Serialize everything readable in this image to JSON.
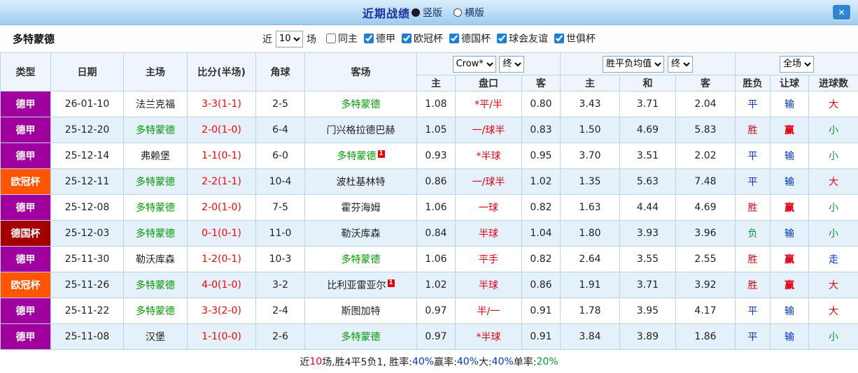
{
  "palette": {
    "red": "#e60012",
    "blue": "#0033cc",
    "green": "#009933",
    "team_green": "#009900",
    "score_red": "#ff0000",
    "handicap_red": "#e60012",
    "league_purple": "#a0009e",
    "league_orange": "#ff5400",
    "league_darkred": "#a40000",
    "row_alt": "#e4f0fa",
    "border": "#bcd4e8"
  },
  "titlebar": {
    "title": "近期战绩",
    "layout_options": [
      {
        "label": "竖版",
        "selected": true
      },
      {
        "label": "横版",
        "selected": false
      }
    ],
    "close_glyph": "✕"
  },
  "filterbar": {
    "team": "多特蒙德",
    "near_label": "近",
    "count_value": "10",
    "games_label": "场",
    "checkboxes": [
      {
        "label": "同主",
        "checked": false
      },
      {
        "label": "德甲",
        "checked": true
      },
      {
        "label": "欧冠杯",
        "checked": true
      },
      {
        "label": "德国杯",
        "checked": true
      },
      {
        "label": "球会友谊",
        "checked": true
      },
      {
        "label": "世俱杯",
        "checked": true
      }
    ]
  },
  "table": {
    "headers": {
      "type": "类型",
      "date": "日期",
      "home": "主场",
      "score": "比分(半场)",
      "corner": "角球",
      "away": "客场",
      "odds_provider": "Crow*",
      "odds_final": "终",
      "avg_label": "胜平负均值",
      "avg_final": "终",
      "period_label": "全场",
      "sub": [
        "主",
        "盘口",
        "客",
        "主",
        "和",
        "客",
        "胜负",
        "让球",
        "进球数"
      ]
    },
    "rows": [
      {
        "league": "德甲",
        "league_color": "league_purple",
        "date": "26-01-10",
        "home": "法兰克福",
        "home_is_team": false,
        "home_card": "",
        "score": "3-3(1-1)",
        "corner": "2-5",
        "away": "多特蒙德",
        "away_is_team": true,
        "away_card": "",
        "odds_home": "1.08",
        "handicap": "*平/半",
        "odds_away": "0.80",
        "avg_home": "3.43",
        "avg_draw": "3.71",
        "avg_away": "2.04",
        "result": "平",
        "result_color": "blue",
        "let_result": "输",
        "let_color": "blue",
        "goals": "大",
        "goals_color": "red"
      },
      {
        "league": "德甲",
        "league_color": "league_purple",
        "date": "25-12-20",
        "home": "多特蒙德",
        "home_is_team": true,
        "home_card": "",
        "score": "2-0(1-0)",
        "corner": "6-4",
        "away": "门兴格拉德巴赫",
        "away_is_team": false,
        "away_card": "",
        "odds_home": "1.05",
        "handicap": "一/球半",
        "odds_away": "0.83",
        "avg_home": "1.50",
        "avg_draw": "4.69",
        "avg_away": "5.83",
        "result": "胜",
        "result_color": "red",
        "let_result": "赢",
        "let_color": "red",
        "goals": "小",
        "goals_color": "green"
      },
      {
        "league": "德甲",
        "league_color": "league_purple",
        "date": "25-12-14",
        "home": "弗赖堡",
        "home_is_team": false,
        "home_card": "",
        "score": "1-1(0-1)",
        "corner": "6-0",
        "away": "多特蒙德",
        "away_is_team": true,
        "away_card": "1",
        "odds_home": "0.93",
        "handicap": "*半球",
        "odds_away": "0.95",
        "avg_home": "3.70",
        "avg_draw": "3.51",
        "avg_away": "2.02",
        "result": "平",
        "result_color": "blue",
        "let_result": "输",
        "let_color": "blue",
        "goals": "小",
        "goals_color": "green"
      },
      {
        "league": "欧冠杯",
        "league_color": "league_orange",
        "date": "25-12-11",
        "home": "多特蒙德",
        "home_is_team": true,
        "home_card": "",
        "score": "2-2(1-1)",
        "corner": "10-4",
        "away": "波杜基林特",
        "away_is_team": false,
        "away_card": "",
        "odds_home": "0.86",
        "handicap": "一/球半",
        "odds_away": "1.02",
        "avg_home": "1.35",
        "avg_draw": "5.63",
        "avg_away": "7.48",
        "result": "平",
        "result_color": "blue",
        "let_result": "输",
        "let_color": "blue",
        "goals": "大",
        "goals_color": "red"
      },
      {
        "league": "德甲",
        "league_color": "league_purple",
        "date": "25-12-08",
        "home": "多特蒙德",
        "home_is_team": true,
        "home_card": "",
        "score": "2-0(1-0)",
        "corner": "7-5",
        "away": "霍芬海姆",
        "away_is_team": false,
        "away_card": "",
        "odds_home": "1.06",
        "handicap": "一球",
        "odds_away": "0.82",
        "avg_home": "1.63",
        "avg_draw": "4.44",
        "avg_away": "4.69",
        "result": "胜",
        "result_color": "red",
        "let_result": "赢",
        "let_color": "red",
        "goals": "小",
        "goals_color": "green"
      },
      {
        "league": "德国杯",
        "league_color": "league_darkred",
        "date": "25-12-03",
        "home": "多特蒙德",
        "home_is_team": true,
        "home_card": "",
        "score": "0-1(0-1)",
        "corner": "11-0",
        "away": "勒沃库森",
        "away_is_team": false,
        "away_card": "",
        "odds_home": "0.84",
        "handicap": "半球",
        "odds_away": "1.04",
        "avg_home": "1.80",
        "avg_draw": "3.93",
        "avg_away": "3.96",
        "result": "负",
        "result_color": "green",
        "let_result": "输",
        "let_color": "blue",
        "goals": "小",
        "goals_color": "green"
      },
      {
        "league": "德甲",
        "league_color": "league_purple",
        "date": "25-11-30",
        "home": "勒沃库森",
        "home_is_team": false,
        "home_card": "",
        "score": "1-2(0-1)",
        "corner": "10-3",
        "away": "多特蒙德",
        "away_is_team": true,
        "away_card": "",
        "odds_home": "1.06",
        "handicap": "平手",
        "odds_away": "0.82",
        "avg_home": "2.64",
        "avg_draw": "3.55",
        "avg_away": "2.55",
        "result": "胜",
        "result_color": "red",
        "let_result": "赢",
        "let_color": "red",
        "goals": "走",
        "goals_color": "blue"
      },
      {
        "league": "欧冠杯",
        "league_color": "league_orange",
        "date": "25-11-26",
        "home": "多特蒙德",
        "home_is_team": true,
        "home_card": "",
        "score": "4-0(1-0)",
        "corner": "3-2",
        "away": "比利亚雷亚尔",
        "away_is_team": false,
        "away_card": "1",
        "odds_home": "1.02",
        "handicap": "半球",
        "odds_away": "0.86",
        "avg_home": "1.91",
        "avg_draw": "3.71",
        "avg_away": "3.92",
        "result": "胜",
        "result_color": "red",
        "let_result": "赢",
        "let_color": "red",
        "goals": "大",
        "goals_color": "red"
      },
      {
        "league": "德甲",
        "league_color": "league_purple",
        "date": "25-11-22",
        "home": "多特蒙德",
        "home_is_team": true,
        "home_card": "",
        "score": "3-3(2-0)",
        "corner": "2-4",
        "away": "斯图加特",
        "away_is_team": false,
        "away_card": "",
        "odds_home": "0.97",
        "handicap": "半/一",
        "odds_away": "0.91",
        "avg_home": "1.78",
        "avg_draw": "3.95",
        "avg_away": "4.17",
        "result": "平",
        "result_color": "blue",
        "let_result": "输",
        "let_color": "blue",
        "goals": "大",
        "goals_color": "red"
      },
      {
        "league": "德甲",
        "league_color": "league_purple",
        "date": "25-11-08",
        "home": "汉堡",
        "home_is_team": false,
        "home_card": "",
        "score": "1-1(0-0)",
        "corner": "2-6",
        "away": "多特蒙德",
        "away_is_team": true,
        "away_card": "",
        "odds_home": "0.97",
        "handicap": "*半球",
        "odds_away": "0.91",
        "avg_home": "3.84",
        "avg_draw": "3.89",
        "avg_away": "1.86",
        "result": "平",
        "result_color": "blue",
        "let_result": "输",
        "let_color": "blue",
        "goals": "小",
        "goals_color": "green"
      }
    ]
  },
  "footer": {
    "segments": [
      {
        "text": "近",
        "color": ""
      },
      {
        "text": "10",
        "color": "red"
      },
      {
        "text": "场,胜4平5负1, 胜率:",
        "color": ""
      },
      {
        "text": "40%",
        "color": "blue"
      },
      {
        "text": " 赢率:",
        "color": ""
      },
      {
        "text": "40%",
        "color": "blue"
      },
      {
        "text": " 大:",
        "color": ""
      },
      {
        "text": "40%",
        "color": "blue"
      },
      {
        "text": " 单率:",
        "color": ""
      },
      {
        "text": "20%",
        "color": "green"
      }
    ]
  }
}
